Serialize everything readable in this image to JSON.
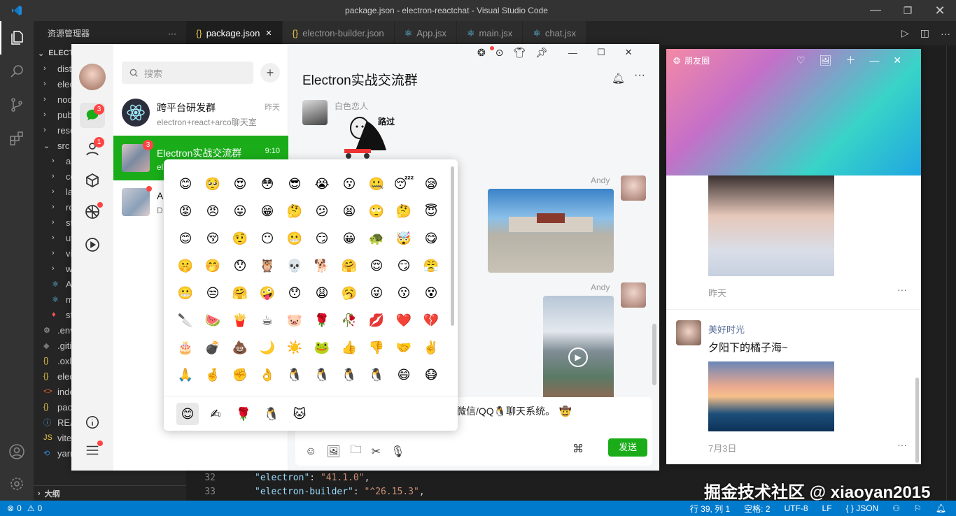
{
  "vscode": {
    "title": "package.json - electron-reactchat - Visual Studio Code",
    "explorer_title": "资源管理器",
    "root": "ELECTRON-REACTCHAT",
    "tree": [
      "dist",
      "electron",
      "node_modules",
      "public",
      "resources",
      "src",
      "assets",
      "components",
      "layouts",
      "router",
      "store",
      "utils",
      "views",
      "windows",
      "App.jsx",
      "main.jsx",
      "style.scss",
      ".env",
      ".gitignore",
      ".oxlintrc.json",
      "electron-builder.json",
      "index.html",
      "package.json",
      "README.md",
      "vite.config.js",
      "yarn.lock"
    ],
    "outline": "大纲",
    "tabs": [
      {
        "label": "package.json",
        "icon": "{}",
        "active": true
      },
      {
        "label": "electron-builder.json",
        "icon": "{}",
        "active": false
      },
      {
        "label": "App.jsx",
        "icon": "⚛",
        "active": false
      },
      {
        "label": "main.jsx",
        "icon": "⚛",
        "active": false
      },
      {
        "label": "chat.jsx",
        "icon": "⚛",
        "active": false
      }
    ],
    "code_lines": [
      {
        "num": "32",
        "key": "\"electron\"",
        "val": "\"41.1.0\""
      },
      {
        "num": "33",
        "key": "\"electron-builder\"",
        "val": "\"^26.15.3\""
      }
    ],
    "status": {
      "errors": "0",
      "warnings": "0",
      "position": "行 39, 列 1",
      "spaces": "空格: 2",
      "encoding": "UTF-8",
      "eol": "LF",
      "lang": "JSON"
    },
    "watermark": "掘金技术社区 @ xiaoyan2015"
  },
  "chat": {
    "search_placeholder": "搜索",
    "nav_badges": {
      "chat": "3",
      "contacts": "1"
    },
    "conversations": [
      {
        "name": "跨平台研发群",
        "time": "昨天",
        "preview": "electron+react+arco聊天室",
        "badge": ""
      },
      {
        "name": "Electron实战交流群",
        "time": "9:10",
        "preview": "el",
        "badge": "3"
      },
      {
        "name": "A",
        "time": "",
        "preview": "D",
        "badge": ""
      }
    ],
    "room_title": "Electron实战交流群",
    "messages": [
      {
        "sender": "白色恋人",
        "text": "路过"
      },
      {
        "sender": "Andy"
      },
      {
        "sender": "Andy"
      }
    ],
    "input_text": "仿微信/QQ",
    "input_text2": "聊天系统。",
    "send_label": "发送",
    "emojis": [
      "😊",
      "🥺",
      "😍",
      "😳",
      "😎",
      "😭",
      "😗",
      "🤐",
      "😴",
      "😪",
      "😡",
      "😠",
      "😛",
      "😁",
      "🤔",
      "😕",
      "😫",
      "🙄",
      "🤔",
      "😇",
      "😊",
      "😚",
      "🤨",
      "😶",
      "😬",
      "😏",
      "😀",
      "🐢",
      "🤯",
      "😋",
      "🤫",
      "🤭",
      "😯",
      "🦉",
      "💀",
      "🐕",
      "🤗",
      "😌",
      "😏",
      "😤",
      "😬",
      "😒",
      "🤗",
      "🤪",
      "😯",
      "😩",
      "🥱",
      "😜",
      "😗",
      "😵",
      "🔪",
      "🍉",
      "🍟",
      "☕",
      "🐷",
      "🌹",
      "🥀",
      "💋",
      "❤️",
      "💔",
      "🎂",
      "💣",
      "💩",
      "🌙",
      "☀️",
      "🐸",
      "👍",
      "👎",
      "🤝",
      "✌️",
      "🙏",
      "🤞",
      "✊",
      "👌",
      "🐧",
      "🐧",
      "🐧",
      "🐧",
      "😄",
      "😷"
    ],
    "emoji_tabs": [
      "😊",
      "✍",
      "🌹",
      "🐧",
      "🐱"
    ]
  },
  "moments": {
    "title": "朋友圈",
    "posts": [
      {
        "time": "昨天"
      },
      {
        "user": "美好时光",
        "text": "夕阳下的橘子海~",
        "time": "7月3日"
      }
    ]
  }
}
